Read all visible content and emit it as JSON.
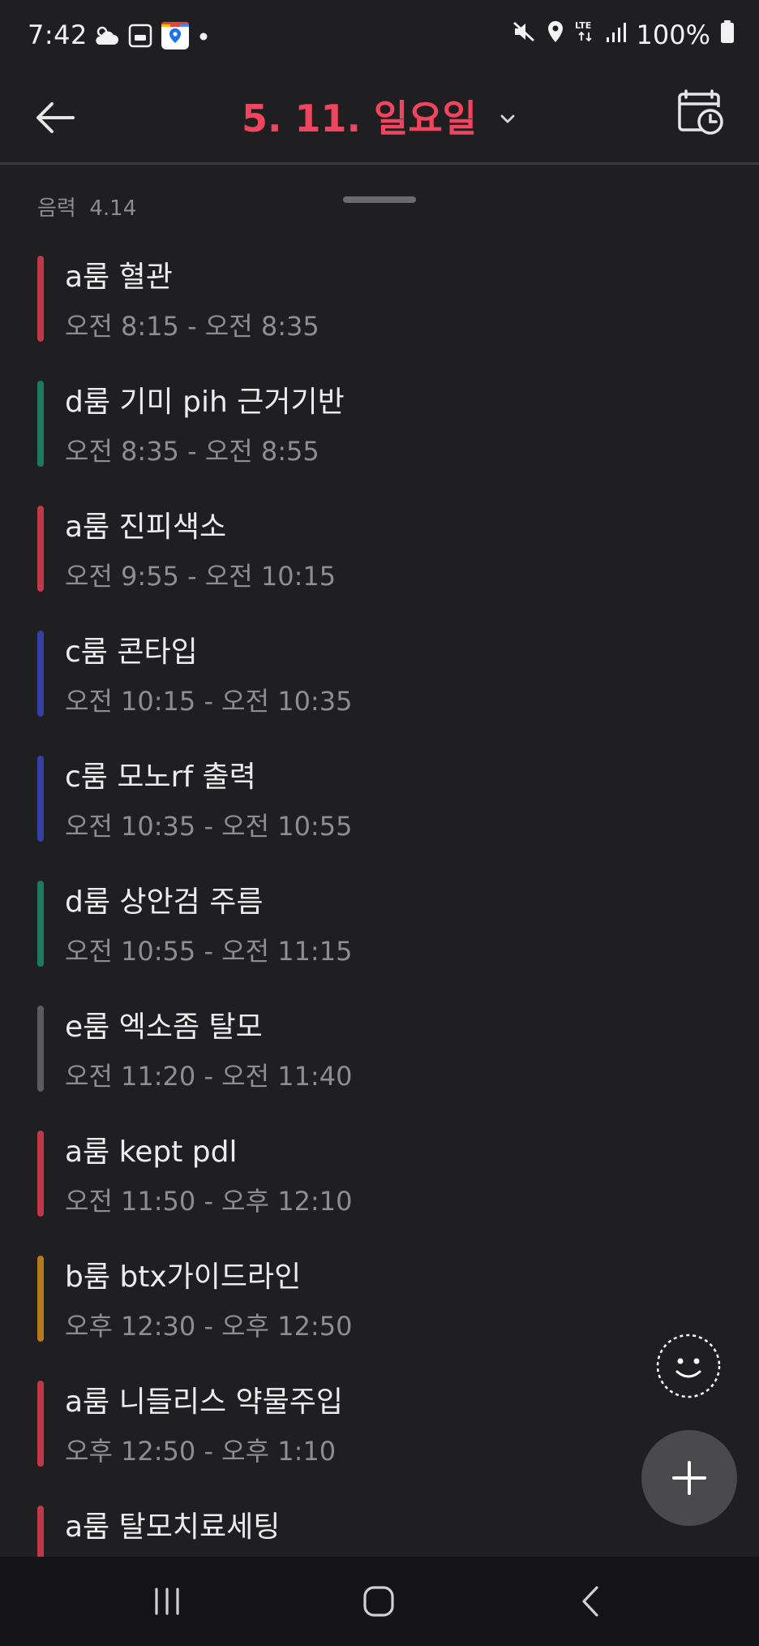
{
  "status_bar": {
    "time": "7:42",
    "left_icons": [
      "weather-icon",
      "app-go-icon",
      "maps-icon",
      "notification-dot-icon"
    ],
    "right_icons": [
      "mute-icon",
      "location-icon",
      "lte-icon",
      "signal-icon",
      "battery-icon"
    ],
    "battery": "100%",
    "network": "LTE"
  },
  "header": {
    "title": "5. 11. 일요일"
  },
  "lunar": {
    "label": "음력",
    "date": "4.14"
  },
  "events": [
    {
      "title": "a룸 혈관",
      "time": "오전 8:15 - 오전 8:35",
      "color": "#c0394a"
    },
    {
      "title": "d룸 기미 pih 근거기반",
      "time": "오전 8:35 - 오전 8:55",
      "color": "#1b7a5e"
    },
    {
      "title": "a룸 진피색소",
      "time": "오전 9:55 - 오전 10:15",
      "color": "#c0394a"
    },
    {
      "title": "c룸 콘타입",
      "time": "오전 10:15 - 오전 10:35",
      "color": "#3640a3"
    },
    {
      "title": "c룸 모노rf 출력",
      "time": "오전 10:35 - 오전 10:55",
      "color": "#3640a3"
    },
    {
      "title": "d룸 상안검 주름",
      "time": "오전 10:55 - 오전 11:15",
      "color": "#1b7a5e"
    },
    {
      "title": "e룸 엑소좀 탈모",
      "time": "오전 11:20 - 오전 11:40",
      "color": "#5c5c60"
    },
    {
      "title": "a룸 kept pdl",
      "time": "오전 11:50 - 오후 12:10",
      "color": "#c0394a"
    },
    {
      "title": "b룸 btx가이드라인",
      "time": "오후 12:30 - 오후 12:50",
      "color": "#b37a1e"
    },
    {
      "title": "a룸 니들리스 약물주입",
      "time": "오후 12:50 - 오후 1:10",
      "color": "#c0394a"
    },
    {
      "title": "a룸 탈모치료세팅",
      "time": "",
      "color": "#c0394a"
    }
  ],
  "colors": {
    "accent": "#f0455e",
    "background": "#1f1f21",
    "nav_background": "#141416",
    "fab": "#4a4a4d"
  }
}
